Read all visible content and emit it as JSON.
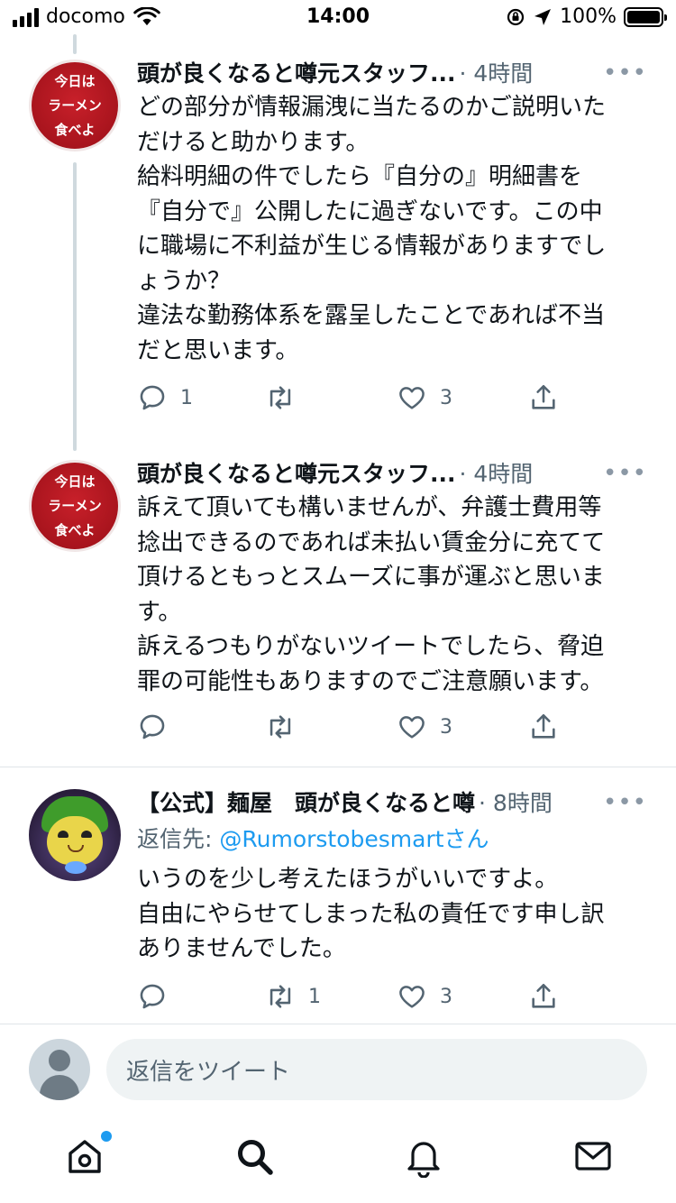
{
  "status_bar": {
    "carrier": "docomo",
    "time": "14:00",
    "battery": "100%",
    "battery_level": 1.0
  },
  "tweets": [
    {
      "name": "頭が良くなると噂元スタッフ...",
      "time": "· 4時間",
      "avatar_text": [
        "今日は",
        "ラーメン",
        "食べよ"
      ],
      "lines": [
        "どの部分が情報漏洩に当たるのかご説明いた",
        "だけると助かります。",
        "給料明細の件でしたら『自分の』明細書を",
        "『自分で』公開したに過ぎないです。この中",
        "に職場に不利益が生じる情報がありますでし",
        "ょうか？",
        "違法な勤務体系を露呈したことであれば不当",
        "だと思います。"
      ],
      "reply_count": "1",
      "retweet_count": "",
      "like_count": "3"
    },
    {
      "name": "頭が良くなると噂元スタッフ...",
      "time": "· 4時間",
      "avatar_text": [
        "今日は",
        "ラーメン",
        "食べよ"
      ],
      "lines": [
        "訴えて頂いても構いませんが、弁護士費用等",
        "捻出できるのであれば未払い賃金分に充てて",
        "頂けるともっとスムーズに事が運ぶと思いま",
        "す。",
        "訴えるつもりがないツイートでしたら、脅迫",
        "罪の可能性もありますのでご注意願います。"
      ],
      "reply_count": "",
      "retweet_count": "",
      "like_count": "3"
    },
    {
      "name": "【公式】麺屋　頭が良くなると噂",
      "time": "· 8時間",
      "reply_prefix": "返信先: ",
      "reply_handle": "@Rumorstobesmartさん",
      "lines": [
        "いうのを少し考えたほうがいいですよ。",
        "自由にやらせてしまった私の責任です申し訳",
        "ありませんでした。"
      ],
      "reply_count": "",
      "retweet_count": "1",
      "like_count": "3"
    }
  ],
  "reply_bar": {
    "placeholder": "返信をツイート"
  },
  "tab_bar": {
    "tabs": [
      "home-icon",
      "search-icon",
      "bell-icon",
      "mail-icon"
    ],
    "home_has_notification": true
  },
  "colors": {
    "accent": "#1d9bf0",
    "text": "#0f1419",
    "secondary": "#536471",
    "thread_line": "#cfd9de"
  }
}
